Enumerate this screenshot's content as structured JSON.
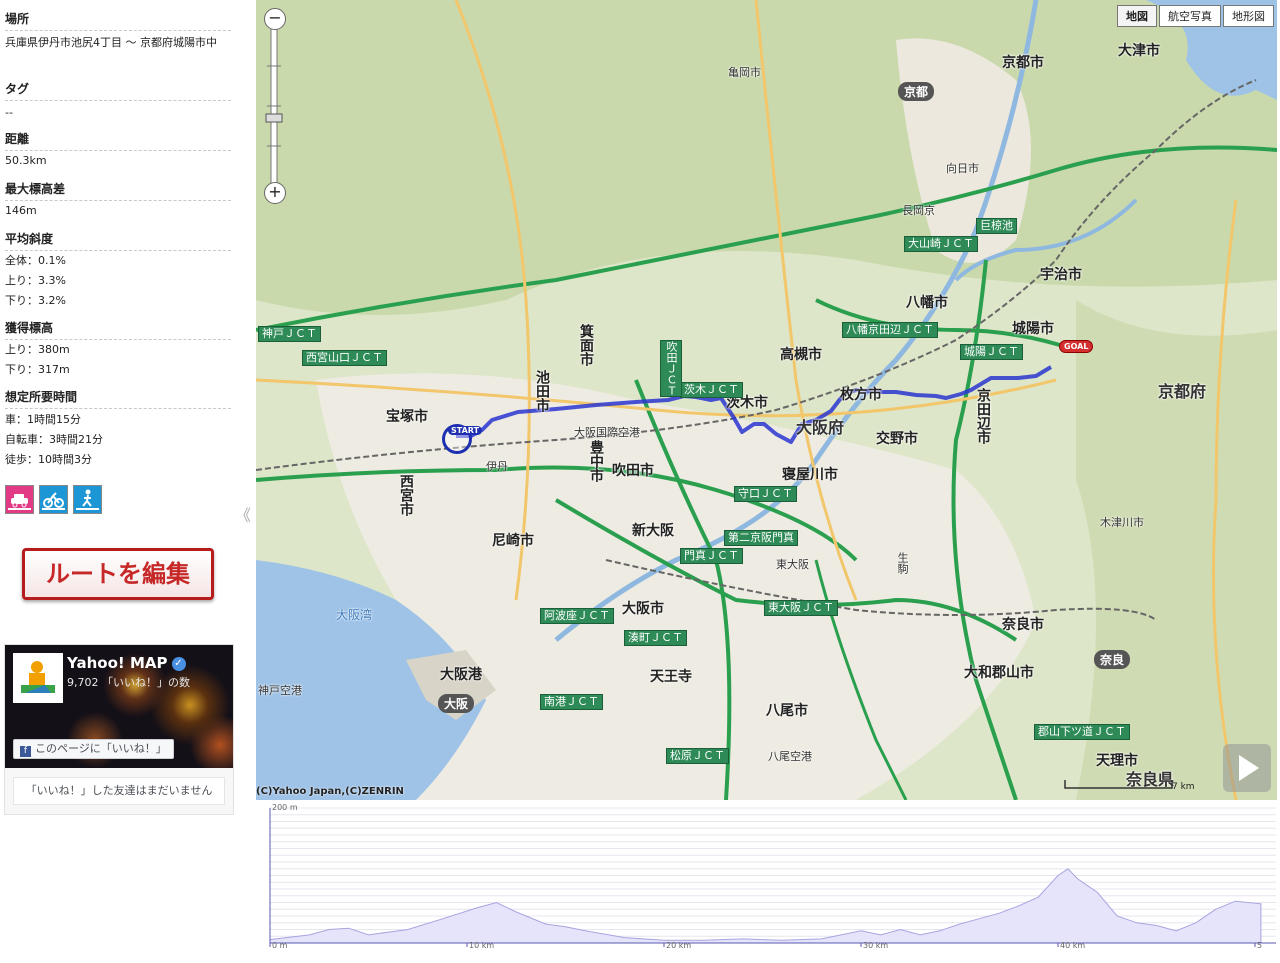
{
  "sidebar": {
    "location_title": "場所",
    "location_value": "兵庫県伊丹市池尻4丁目 〜 京都府城陽市中",
    "tag_title": "タグ",
    "tag_value": "--",
    "distance_title": "距離",
    "distance_value": "50.3km",
    "max_elev_title": "最大標高差",
    "max_elev_value": "146m",
    "avg_slope_title": "平均斜度",
    "avg_slope_all": "全体：0.1%",
    "avg_slope_up": "上り：3.3%",
    "avg_slope_down": "下り：3.2%",
    "gain_title": "獲得標高",
    "gain_up": "上り：380m",
    "gain_down": "下り：317m",
    "time_title": "想定所要時間",
    "time_car": "車：1時間15分",
    "time_bike": "自転車：3時間21分",
    "time_walk": "徒歩：10時間3分",
    "transport_icons": [
      "car-icon",
      "bicycle-icon",
      "walk-icon"
    ],
    "edit_button": "ルートを編集",
    "collapse_glyph": "《"
  },
  "facebook": {
    "page_name": "Yahoo! MAP",
    "likes": "9,702 「いいね！」の数",
    "like_button": "このページに「いいね！」",
    "friends_text": "「いいね！」した友達はまだいません"
  },
  "map": {
    "type_buttons": [
      "地図",
      "航空写真",
      "地形図"
    ],
    "active_type": "地図",
    "copyright": "(C)Yahoo Japan,(C)ZENRIN",
    "scale_label": "7 km",
    "zoom_in": "+",
    "zoom_out": "−",
    "start_label": "START",
    "goal_label": "GOAL",
    "route_color": "#2a35d0",
    "labels": {
      "otsu": "大津市",
      "kyoto": "京都市",
      "kyoto_pref": "京都府",
      "osaka_pref": "大阪府",
      "osaka_city": "大阪市",
      "nara_city": "奈良市",
      "nara_pref": "奈良県",
      "takatsuki": "高槻市",
      "ibaraki": "茨木市",
      "hirakata": "枚方市",
      "kyotanabe": "京田辺市",
      "joyo": "城陽市",
      "uji": "宇治市",
      "itami": "伊丹",
      "ikeda": "池田市",
      "toyonaka": "豊中市",
      "suita": "吹田市",
      "amagasaki": "尼崎市",
      "nishinomiya": "西宮市",
      "takarazuka": "宝塚市",
      "mino": "箕面市",
      "kameoka": "亀岡市",
      "osaka_bay": "大阪湾",
      "osaka_port": "大阪港",
      "kobe_airport": "神戸空港",
      "yao": "八尾市",
      "kizugawa": "木津川市",
      "kadoma": "門真",
      "moriguchi": "守口",
      "neyagawa": "寝屋川市",
      "katano": "交野市",
      "higashiosaka": "東大阪",
      "ikoma": "生駒",
      "yamatokoriyama": "大和郡山市",
      "tenri": "天理市",
      "yawata": "八幡市",
      "nagaokakyo": "長岡京",
      "muko": "向日市",
      "shinosaka": "新大阪",
      "tennoji": "天王寺",
      "itami_airport": "大阪国際空港",
      "yao_airport": "八尾空港",
      "kyoto_station": "京都",
      "osaka_station": "大阪",
      "nara_station": "奈良"
    },
    "jct_shields": [
      "城陽ＪＣＴ",
      "大山崎ＪＣＴ",
      "茨木ＪＣＴ",
      "吹田ＪＣＴ",
      "守口ＪＣＴ",
      "門真ＪＣＴ",
      "東大阪ＪＣＴ",
      "阿波座ＪＣＴ",
      "湊町ＪＣＴ",
      "松原ＪＣＴ",
      "西宮山口ＪＣＴ",
      "神戸ＪＣＴ",
      "八幡京田辺ＪＣＴ",
      "郡山下ツ道ＪＣＴ",
      "巨椋池",
      "南港ＪＣＴ",
      "第二京阪門真"
    ]
  },
  "elevation": {
    "y_max_label": "200 m",
    "x_ticks": [
      "0 m",
      "10 km",
      "20 km",
      "30 km",
      "40 km",
      "5"
    ],
    "profile": [
      [
        0,
        5
      ],
      [
        2,
        12
      ],
      [
        3,
        20
      ],
      [
        4,
        22
      ],
      [
        5,
        12
      ],
      [
        7,
        20
      ],
      [
        9,
        38
      ],
      [
        10.5,
        52
      ],
      [
        11.5,
        60
      ],
      [
        12.5,
        46
      ],
      [
        14,
        28
      ],
      [
        15,
        24
      ],
      [
        16,
        18
      ],
      [
        18,
        8
      ],
      [
        20,
        4
      ],
      [
        22,
        4
      ],
      [
        24,
        6
      ],
      [
        26,
        4
      ],
      [
        28,
        6
      ],
      [
        30,
        18
      ],
      [
        31,
        12
      ],
      [
        32,
        20
      ],
      [
        33,
        12
      ],
      [
        34,
        18
      ],
      [
        35,
        28
      ],
      [
        36,
        36
      ],
      [
        37,
        44
      ],
      [
        38,
        55
      ],
      [
        39,
        68
      ],
      [
        40,
        100
      ],
      [
        40.5,
        110
      ],
      [
        41,
        95
      ],
      [
        42,
        75
      ],
      [
        43,
        40
      ],
      [
        44,
        30
      ],
      [
        45,
        26
      ],
      [
        46,
        18
      ],
      [
        47,
        30
      ],
      [
        48,
        50
      ],
      [
        49,
        62
      ],
      [
        50.3,
        58
      ]
    ]
  }
}
